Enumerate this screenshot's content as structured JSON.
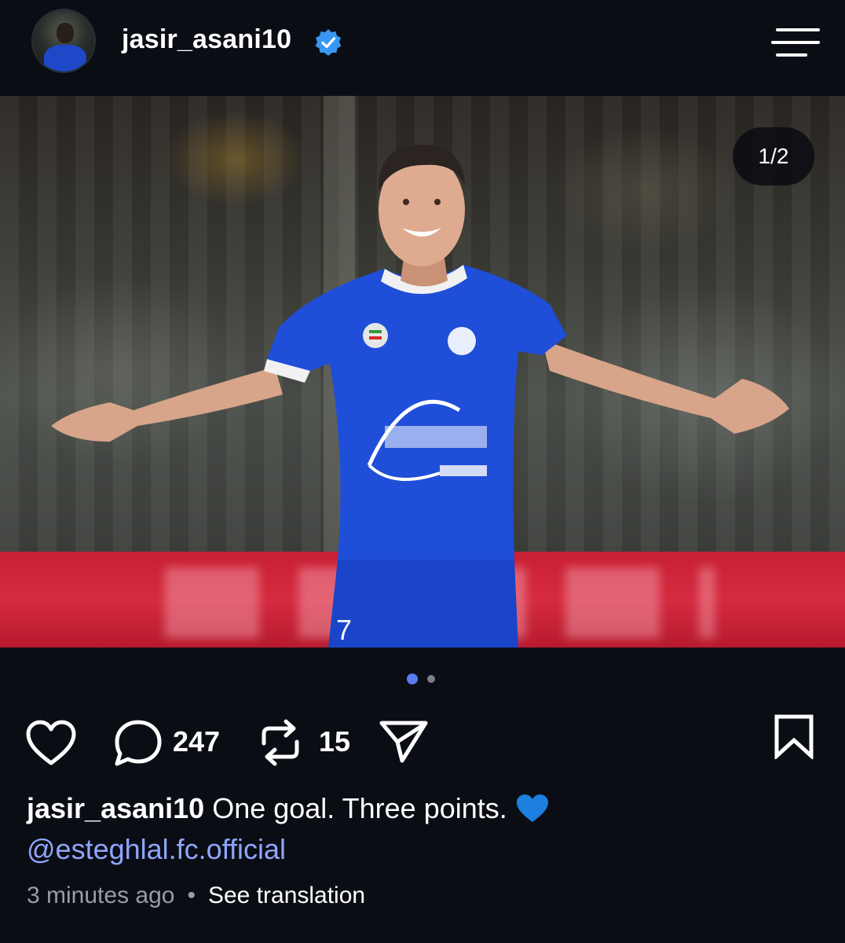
{
  "post": {
    "username": "jasir_asani10",
    "verified": true,
    "image_counter": "1/2",
    "slide_count": 2,
    "active_slide": 1,
    "comments_count": "247",
    "reposts_count": "15",
    "caption_user": "jasir_asani10",
    "caption_text": " One goal. Three points. ",
    "caption_emoji": "💙",
    "mention": "@esteghlal.fc.official",
    "timestamp": "3 minutes ago",
    "separator": "•",
    "see_translation": "See translation"
  },
  "icons": {
    "avatar": "profile-avatar",
    "verified": "verified-badge-icon",
    "menu": "menu-icon",
    "like": "heart-icon",
    "comment": "comment-icon",
    "repost": "repost-icon",
    "share": "send-icon",
    "save": "bookmark-icon"
  },
  "colors": {
    "background": "#0b0d14",
    "verified_badge": "#3897f0",
    "mention": "#8fa6ff",
    "active_dot": "#5b7cf0",
    "jersey": "#1d48c8"
  }
}
